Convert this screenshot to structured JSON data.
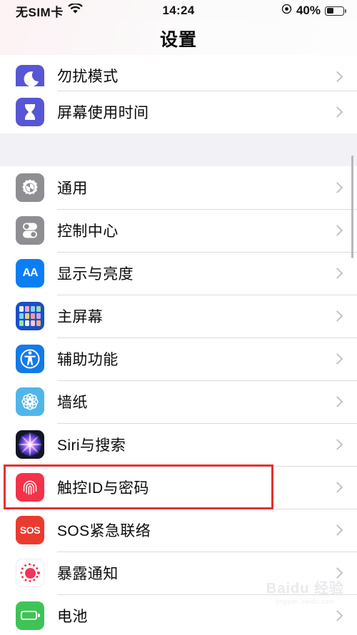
{
  "status_bar": {
    "carrier": "无SIM卡",
    "wifi_icon": "wifi-icon",
    "time": "14:24",
    "rotation_lock_icon": "rotation-lock-icon",
    "battery_percent": "40%",
    "battery_level": 40,
    "battery_icon": "battery-icon"
  },
  "nav": {
    "title": "设置"
  },
  "groups": [
    {
      "rows": [
        {
          "label": "勿扰模式",
          "icon": "moon-icon",
          "icon_class": "ic-dnd",
          "partial": true,
          "chevron": "chevron-right-icon"
        },
        {
          "label": "屏幕使用时间",
          "icon": "hourglass-icon",
          "icon_class": "ic-screentime",
          "partial": false,
          "chevron": "chevron-right-icon"
        }
      ]
    },
    {
      "rows": [
        {
          "label": "通用",
          "icon": "gear-icon",
          "icon_class": "ic-general",
          "partial": false,
          "chevron": "chevron-right-icon"
        },
        {
          "label": "控制中心",
          "icon": "toggles-icon",
          "icon_class": "ic-control",
          "partial": false,
          "chevron": "chevron-right-icon"
        },
        {
          "label": "显示与亮度",
          "icon": "aa-text-icon",
          "icon_class": "ic-display",
          "partial": false,
          "chevron": "chevron-right-icon"
        },
        {
          "label": "主屏幕",
          "icon": "app-grid-icon",
          "icon_class": "ic-home",
          "partial": false,
          "chevron": "chevron-right-icon"
        },
        {
          "label": "辅助功能",
          "icon": "accessibility-icon",
          "icon_class": "ic-access",
          "partial": false,
          "chevron": "chevron-right-icon"
        },
        {
          "label": "墙纸",
          "icon": "flower-icon",
          "icon_class": "ic-wallpaper",
          "partial": false,
          "chevron": "chevron-right-icon"
        },
        {
          "label": "Siri与搜索",
          "icon": "siri-orb-icon",
          "icon_class": "ic-siri",
          "partial": false,
          "chevron": "chevron-right-icon"
        },
        {
          "label": "触控ID与密码",
          "icon": "fingerprint-icon",
          "icon_class": "ic-touchid",
          "partial": false,
          "chevron": "chevron-right-icon",
          "highlighted": true
        },
        {
          "label": "SOS紧急联络",
          "icon": "sos-icon",
          "icon_class": "ic-sos",
          "partial": false,
          "chevron": "chevron-right-icon",
          "sos_label": "SOS"
        },
        {
          "label": "暴露通知",
          "icon": "exposure-notification-icon",
          "icon_class": "ic-exposure",
          "partial": false,
          "chevron": "chevron-right-icon"
        },
        {
          "label": "电池",
          "icon": "battery-icon",
          "icon_class": "ic-battery",
          "partial": false,
          "chevron": "chevron-right-icon"
        }
      ]
    }
  ],
  "display_brightness_icon_text": "AA",
  "watermark": {
    "main": "Baidu 经验",
    "sub": "jingyan.baidu.com"
  },
  "colors": {
    "highlight": "#e23232",
    "group_gap": "#f1f1f6",
    "separator": "#dcdcdf",
    "chevron": "#c2c2c6"
  }
}
